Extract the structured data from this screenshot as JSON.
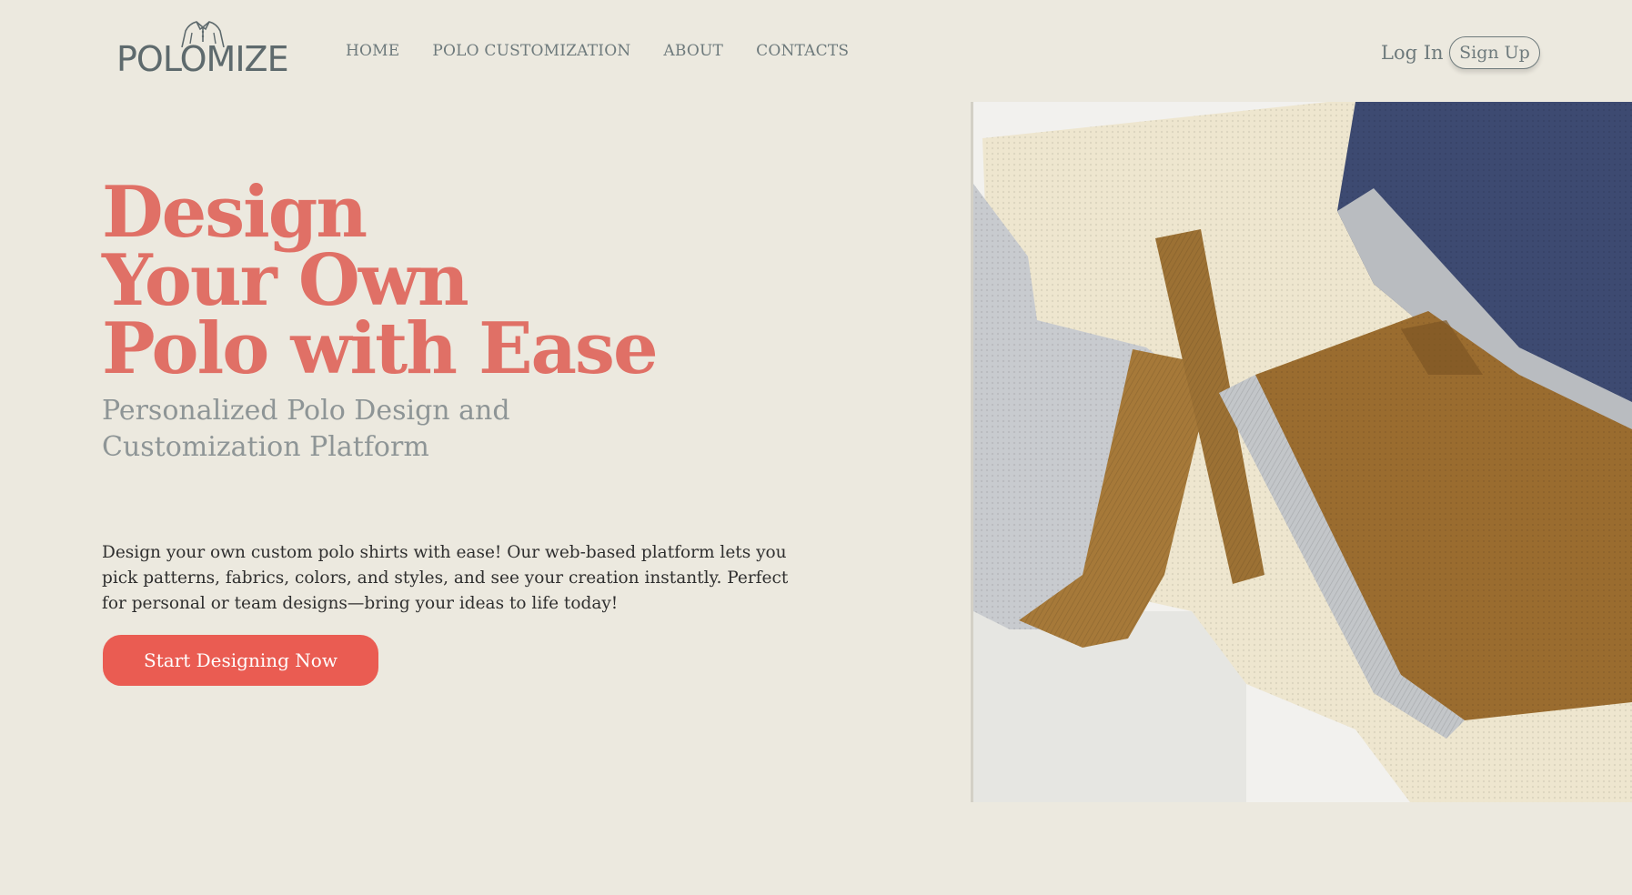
{
  "brand": {
    "name": "POLOMIZE",
    "logo_icon": "polo-shirt-icon"
  },
  "nav": {
    "items": [
      {
        "label": "HOME"
      },
      {
        "label": "POLO CUSTOMIZATION"
      },
      {
        "label": "ABOUT"
      },
      {
        "label": "CONTACTS"
      }
    ]
  },
  "auth": {
    "login_label": "Log In",
    "signup_label": "Sign Up"
  },
  "hero": {
    "title_lines": [
      "Design",
      "Your Own",
      "Polo with Ease"
    ],
    "subtitle": "Personalized Polo Design and Customization Platform",
    "description": "Design your own custom polo shirts with ease! Our web-based platform lets you pick patterns, fabrics, colors, and styles, and see your creation instantly. Perfect for personal or team designs—bring your ideas to life today!",
    "cta_label": "Start Designing Now",
    "image": "polo-shirt-fabrics-photo"
  },
  "colors": {
    "background": "#ECE9DF",
    "accent": "#E07066",
    "cta": "#EA5C52",
    "muted_text": "#6e7a7c"
  }
}
